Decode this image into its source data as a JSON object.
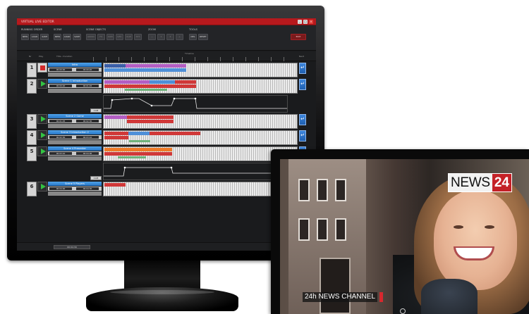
{
  "app": {
    "title": "VIRTUAL LIVE EDITOR",
    "window_buttons": [
      "_",
      "□",
      "×"
    ]
  },
  "toolbar": {
    "groups": [
      {
        "label": "RUNNING ORDER",
        "buttons": [
          "NEW",
          "LOAD",
          "SAVE"
        ]
      },
      {
        "label": "SCENE",
        "buttons": [
          "NEW",
          "LOAD",
          "SAVE"
        ]
      },
      {
        "label": "SCENE OBJECTS",
        "buttons": [
          "AUDIO",
          "FX",
          "CAM",
          "GFX",
          "CLIP",
          "TXT"
        ]
      },
      {
        "label": "ZOOM",
        "buttons": [
          "−",
          "1",
          "2",
          "+"
        ]
      },
      {
        "label": "TOOLS",
        "buttons": [
          "DEL",
          "RESET"
        ]
      }
    ],
    "alert_button": "EXIT"
  },
  "columns": {
    "nr": "Nr",
    "play": "Play",
    "title_duration": "Title - Duration",
    "timeline": "Timeline",
    "next": "Next"
  },
  "scenes": [
    {
      "number": "1",
      "title": "Intro",
      "tc_in": "00:00:00",
      "tc_out": "00:00:20",
      "state": "stop",
      "next_active": true
    },
    {
      "number": "2",
      "title": "Scene 1 Introduction",
      "tc_in": "00:00:20",
      "tc_out": "00:01:45",
      "state": "play",
      "next_active": true
    },
    {
      "number": "3",
      "title": "Scene 2 Game",
      "tc_in": "00:01:45",
      "tc_out": "00:02:30",
      "state": "play",
      "next_active": true
    },
    {
      "number": "4",
      "title": "Scene 3 Introduction 2",
      "tc_in": "00:02:30",
      "tc_out": "00:03:10",
      "state": "play",
      "next_active": true
    },
    {
      "number": "5",
      "title": "Scene 4 Presenter",
      "tc_in": "00:03:10",
      "tc_out": "00:04:00",
      "state": "play",
      "next_active": true
    },
    {
      "number": "6",
      "title": "Scene 5 Players",
      "tc_in": "00:04:00",
      "tc_out": "00:04:30",
      "state": "play",
      "next_active": false
    }
  ],
  "curve_tags": [
    "CAM",
    "CAM"
  ],
  "footer": {
    "timecode": "00:04:30"
  },
  "tv": {
    "logo_word": "NEWS",
    "logo_number": "24",
    "ticker": "24h NEWS CHANNEL"
  },
  "colors": {
    "titlebar": "#b6191d",
    "scene_title": "#2674c5",
    "play_green": "#34c343",
    "stop_red": "#d42b2b",
    "news_red": "#c42127"
  }
}
